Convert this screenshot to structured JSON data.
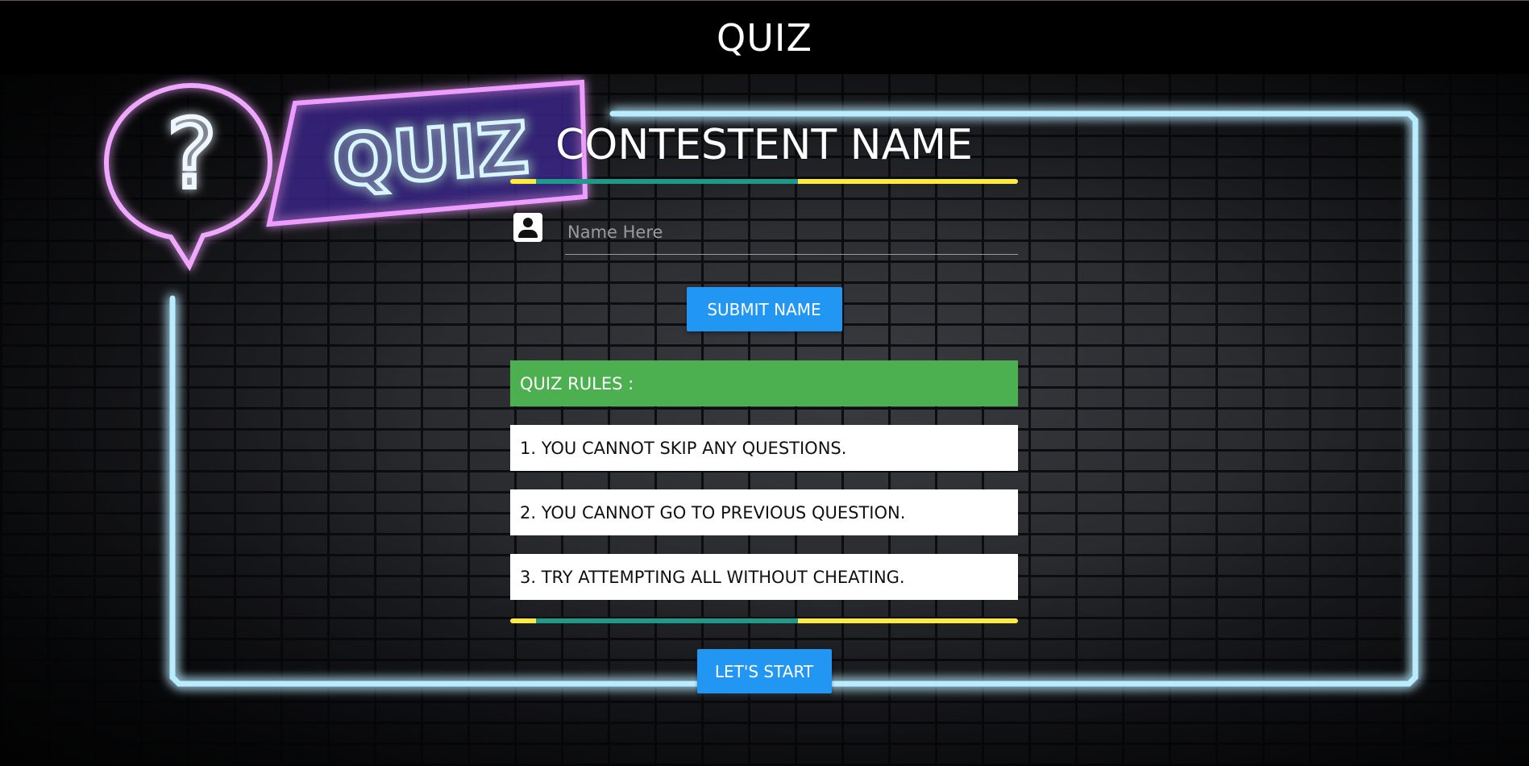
{
  "header": {
    "title": "QUIZ"
  },
  "background": {
    "logo_text": "QUIZ",
    "logo_symbol": "?"
  },
  "form": {
    "title": "CONTESTENT NAME",
    "name_placeholder": "Name Here",
    "name_value": "",
    "user_icon": "user-icon",
    "submit_label": "SUBMIT NAME"
  },
  "rules": {
    "header": "QUIZ RULES :",
    "items": [
      "1. YOU CANNOT SKIP ANY QUESTIONS.",
      "2. YOU CANNOT GO TO PREVIOUS QUESTION.",
      "3. TRY ATTEMPTING ALL WITHOUT CHEATING."
    ]
  },
  "actions": {
    "start_label": "LET'S START"
  },
  "colors": {
    "topbar": "#000000",
    "button": "#2196f3",
    "rules_header": "#4caf50",
    "stripe_yellow": "#ffeb3b",
    "stripe_teal": "#1f9a8a",
    "neon_blue": "#7fd8ff",
    "neon_pink": "#e58cff"
  }
}
